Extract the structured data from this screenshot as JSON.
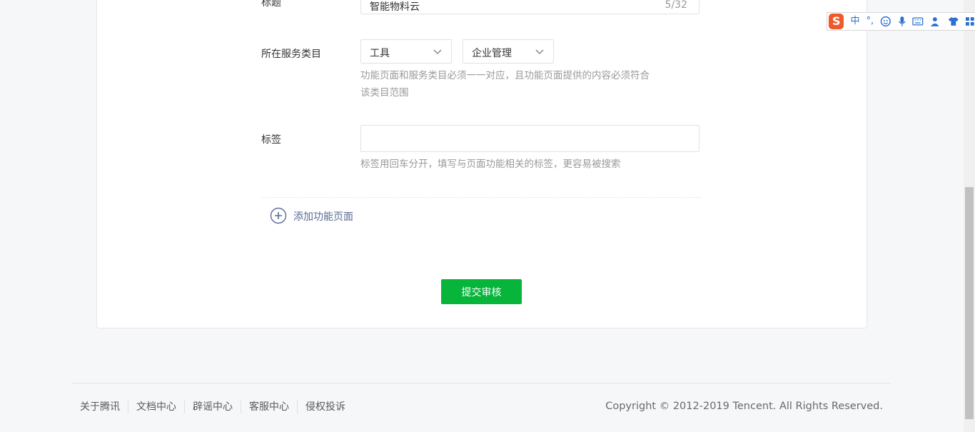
{
  "form": {
    "title_label": "标题",
    "title_value": "智能物料云",
    "title_counter": "5/32",
    "category_label": "所在服务类目",
    "category_primary": "工具",
    "category_secondary": "企业管理",
    "category_hint_line1": "功能页面和服务类目必须一一对应，且功能页面提供的内容必须符合",
    "category_hint_line2": "该类目范围",
    "tags_label": "标签",
    "tags_value": "",
    "tags_hint": "标签用回车分开，填写与页面功能相关的标签，更容易被搜索",
    "add_page_label": "添加功能页面",
    "submit_label": "提交审核"
  },
  "footer": {
    "links": [
      "关于腾讯",
      "文档中心",
      "辟谣中心",
      "客服中心",
      "侵权投诉"
    ],
    "copyright": "Copyright © 2012-2019 Tencent. All Rights Reserved."
  },
  "ime_toolbar": {
    "logo": "S",
    "mode": "中",
    "punct": "°,",
    "icons": [
      "emoji-icon",
      "microphone-icon",
      "keyboard-icon",
      "user-icon",
      "skin-icon",
      "grid-icon"
    ]
  },
  "colors": {
    "accent_green": "#07b53b",
    "link_blue": "#576b95"
  }
}
